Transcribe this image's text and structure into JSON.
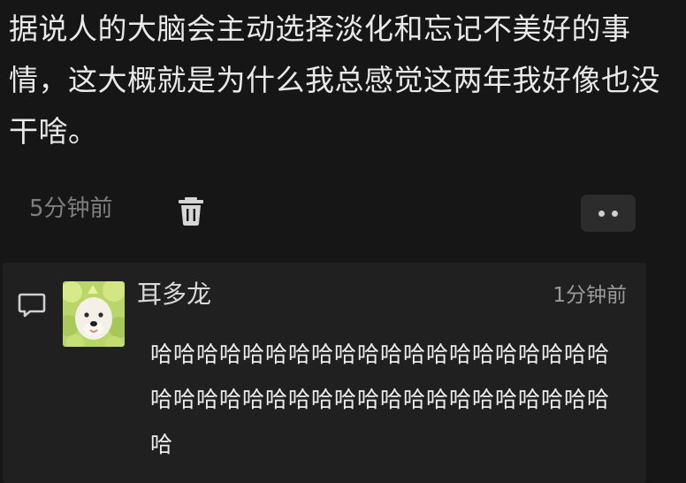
{
  "post": {
    "text": "据说人的大脑会主动选择淡化和忘记不美好的事情，这大概就是为什么我总感觉这两年我好像也没干啥。",
    "time": "5分钟前",
    "delete_icon": "trash-icon",
    "more_icon": "more-dots-icon"
  },
  "reply": {
    "icon": "comment-icon",
    "avatar": "dog-avatar",
    "author": "耳多龙",
    "time": "1分钟前",
    "text": "哈哈哈哈哈哈哈哈哈哈哈哈哈哈哈哈哈哈哈哈哈哈哈哈哈哈哈哈哈哈哈哈哈哈哈哈哈哈哈哈哈"
  },
  "colors": {
    "background": "#161616",
    "card": "#202020",
    "text": "#e9e9e9",
    "muted": "#7f7f7f"
  }
}
